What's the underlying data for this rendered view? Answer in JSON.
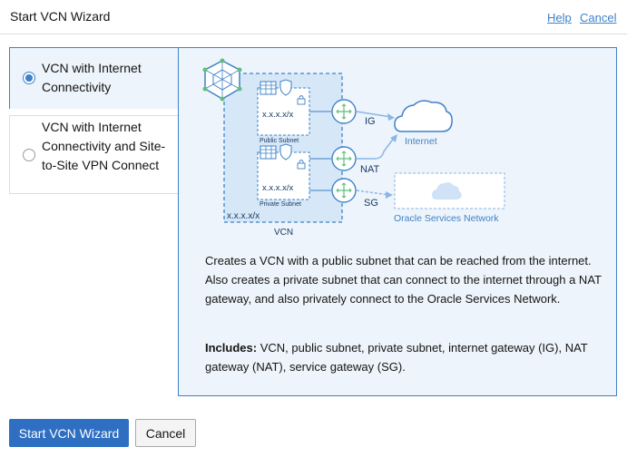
{
  "header": {
    "title": "Start VCN Wizard",
    "help_label": "Help",
    "cancel_label": "Cancel"
  },
  "options": [
    {
      "label": "VCN with Internet Connectivity",
      "selected": true
    },
    {
      "label": "VCN with Internet Connectivity and Site-to-Site VPN Connect",
      "selected": false
    }
  ],
  "diagram": {
    "public_cidr": "x.x.x.x/x",
    "public_subnet_label": "Public Subnet",
    "private_cidr": "x.x.x.x/x",
    "private_subnet_label": "Private Subnet",
    "vcn_cidr": "x.x.x.x/x",
    "vcn_label": "VCN",
    "ig_label": "IG",
    "nat_label": "NAT",
    "sg_label": "SG",
    "internet_label": "Internet",
    "osn_label": "Oracle Services Network"
  },
  "description": "Creates a VCN with a public subnet that can be reached from the internet. Also creates a private subnet that can connect to the internet through a NAT gateway, and also privately connect to the Oracle Services Network.",
  "includes": {
    "label": "Includes:",
    "text": "VCN, public subnet, private subnet, internet gateway (IG), NAT gateway (NAT), service gateway (SG)."
  },
  "footer": {
    "primary_label": "Start VCN Wizard",
    "cancel_label": "Cancel"
  },
  "colors": {
    "accent": "#3f82c8",
    "primary_button": "#2e6fc2",
    "panel_bg": "#edf4fb",
    "diagram_line": "#8ab6e6",
    "vcn_fill": "#d6e7f8",
    "hub_green": "#5fbf7a"
  }
}
